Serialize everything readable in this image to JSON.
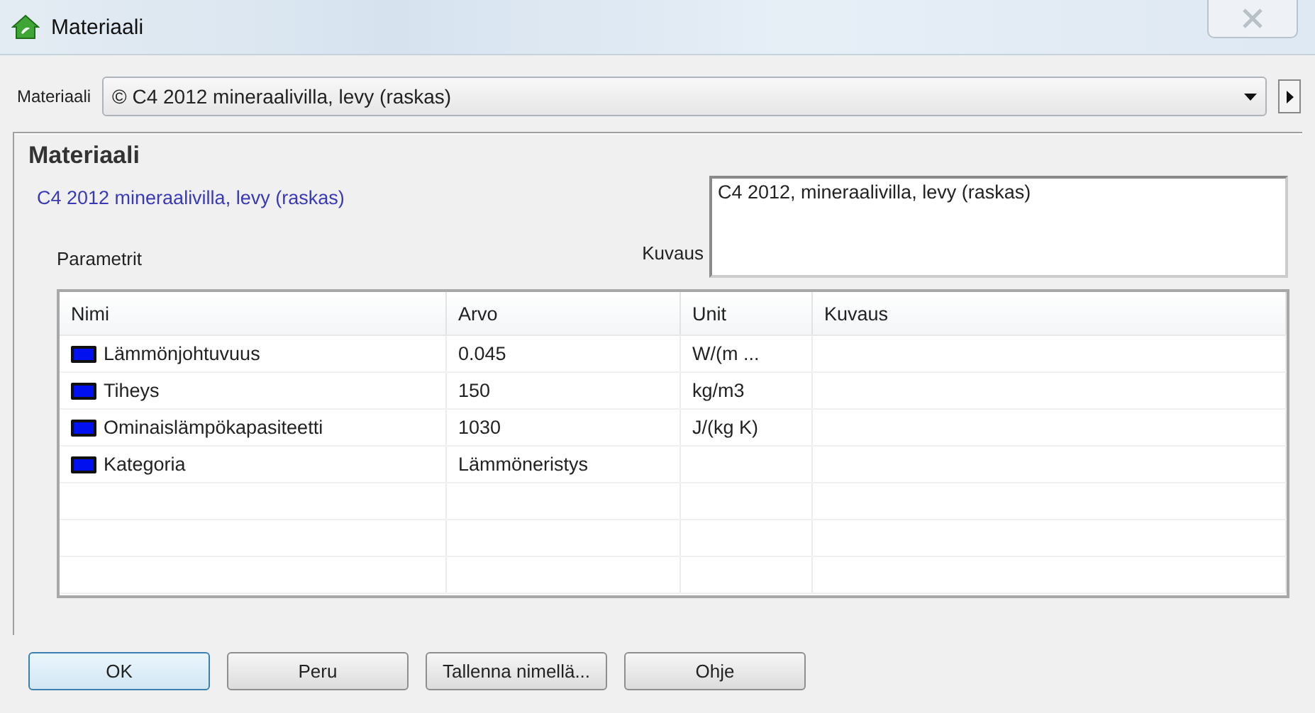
{
  "window": {
    "title": "Materiaali"
  },
  "material_select": {
    "label": "Materiaali",
    "value": "© C4 2012 mineraalivilla, levy (raskas)"
  },
  "panel": {
    "heading": "Materiaali",
    "name": "C4 2012 mineraalivilla, levy (raskas)",
    "description_label": "Kuvaus",
    "description": "C4 2012, mineraalivilla, levy (raskas)",
    "parameters_label": "Parametrit"
  },
  "table": {
    "columns": [
      "Nimi",
      "Arvo",
      "Unit",
      "Kuvaus"
    ],
    "rows": [
      {
        "name": "Lämmönjohtuvuus",
        "value": "0.045",
        "unit": "W/(m ..."
      },
      {
        "name": "Tiheys",
        "value": "150",
        "unit": "kg/m3"
      },
      {
        "name": "Ominaislämpökapasiteetti",
        "value": "1030",
        "unit": "J/(kg K)"
      },
      {
        "name": "Kategoria",
        "value": "Lämmöneristys"
      }
    ]
  },
  "buttons": [
    "OK",
    "Peru",
    "Tallenna nimellä...",
    "Ohje"
  ]
}
